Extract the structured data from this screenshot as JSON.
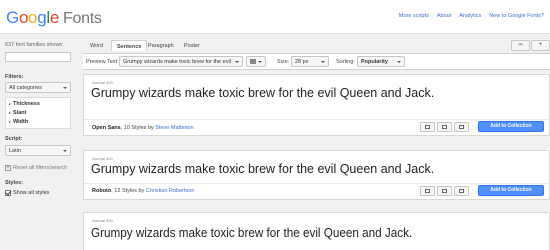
{
  "header": {
    "logo_google": [
      "G",
      "o",
      "o",
      "g",
      "l",
      "e"
    ],
    "logo_fonts": "Fonts",
    "links": [
      "More scripts",
      "About",
      "Analytics",
      "New to Google Fonts?"
    ]
  },
  "sidebar": {
    "family_count": "637 font families shown",
    "search": {
      "value": "",
      "placeholder": ""
    },
    "filters_label": "Filters:",
    "category": "All categories",
    "filter_items": [
      "Thickness",
      "Slant",
      "Width"
    ],
    "script_label": "Script:",
    "script": "Latin",
    "reset": "Reset all filters/search",
    "styles_label": "Styles:",
    "show_all_styles": "Show all styles"
  },
  "tabs": {
    "items": [
      "Word",
      "Sentence",
      "Paragraph",
      "Poster"
    ],
    "active": "Sentence"
  },
  "controls": {
    "preview_label": "Preview Text:",
    "preview_value": "Grumpy wizards make toxic brew for the evil",
    "size_label": "Size:",
    "size_value": "28 px",
    "sorting_label": "Sorting:",
    "sorting_value": "Popularity"
  },
  "cards": [
    {
      "weight": "Normal 400",
      "sample": "Grumpy wizards make toxic brew for the evil Queen and Jack.",
      "family": "Open Sans",
      "styles": ", 10 Styles by ",
      "author": "Steve Matteson",
      "add_label": "Add to Collection"
    },
    {
      "weight": "Normal 400",
      "sample": "Grumpy wizards make toxic brew for the evil Queen and Jack.",
      "family": "Roboto",
      "styles": ", 12 Styles by ",
      "author": "Christian Robertson",
      "add_label": "Add to Collection"
    },
    {
      "weight": "Normal 400",
      "sample": "Grumpy wizards make toxic brew for the evil Queen and Jack."
    }
  ],
  "colors": {
    "accent": "#4d90fe",
    "link": "#3a6ec9",
    "background": "#f1f1f1"
  }
}
